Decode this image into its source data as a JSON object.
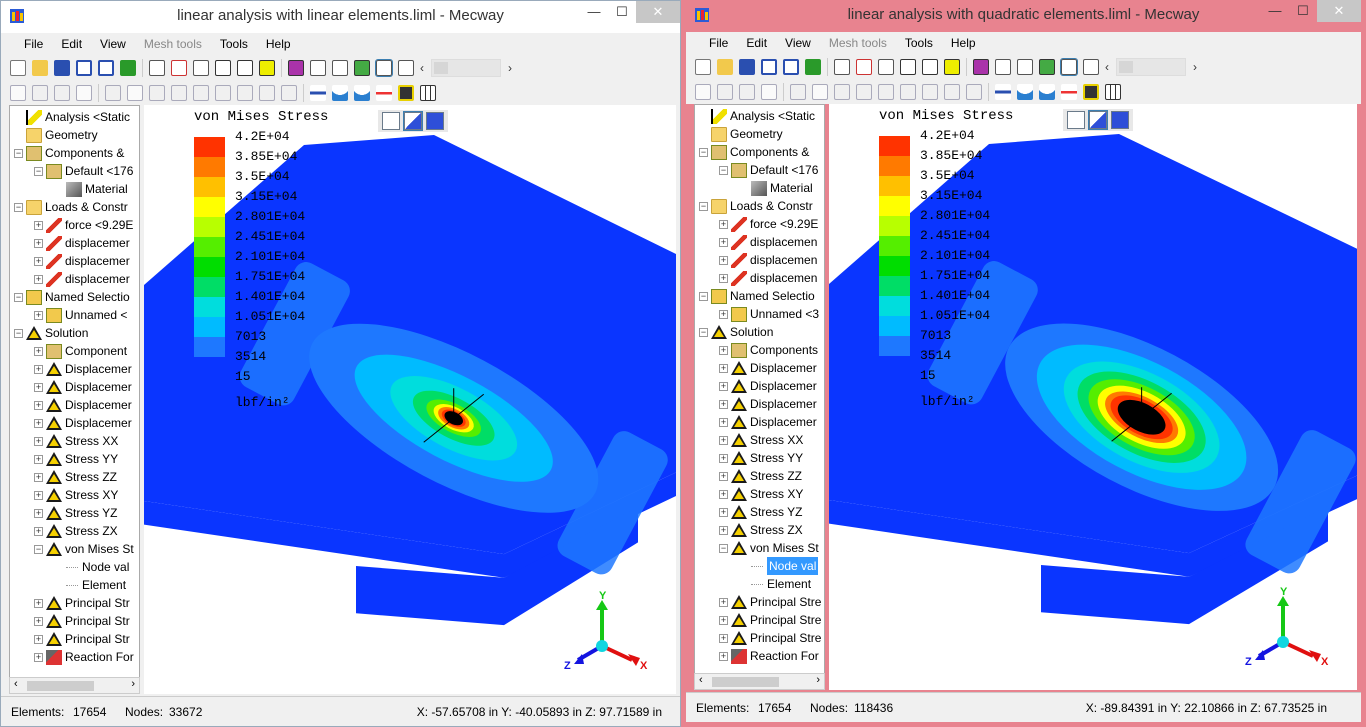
{
  "windows": [
    {
      "title": "linear analysis with linear elements.liml - Mecway",
      "menus": [
        "File",
        "Edit",
        "View",
        "Mesh tools",
        "Tools",
        "Help"
      ],
      "tree": [
        {
          "indent": 0,
          "icon": "bolt",
          "exp": "",
          "label": "Analysis <Static"
        },
        {
          "indent": 0,
          "icon": "folder",
          "exp": "",
          "label": "Geometry"
        },
        {
          "indent": 0,
          "icon": "comp",
          "exp": "−",
          "label": "Components &"
        },
        {
          "indent": 1,
          "icon": "comp",
          "exp": "−",
          "label": "Default <176"
        },
        {
          "indent": 2,
          "icon": "mat",
          "exp": "",
          "label": "Material"
        },
        {
          "indent": 0,
          "icon": "folder",
          "exp": "−",
          "label": "Loads & Constr"
        },
        {
          "indent": 1,
          "icon": "arrow",
          "exp": "+",
          "label": "force <9.29E"
        },
        {
          "indent": 1,
          "icon": "arrow",
          "exp": "+",
          "label": "displacemer"
        },
        {
          "indent": 1,
          "icon": "arrow",
          "exp": "+",
          "label": "displacemer"
        },
        {
          "indent": 1,
          "icon": "arrow",
          "exp": "+",
          "label": "displacemer"
        },
        {
          "indent": 0,
          "icon": "box",
          "exp": "−",
          "label": "Named Selectio"
        },
        {
          "indent": 1,
          "icon": "box",
          "exp": "+",
          "label": "Unnamed <"
        },
        {
          "indent": 0,
          "icon": "tri",
          "exp": "−",
          "label": "Solution"
        },
        {
          "indent": 1,
          "icon": "comp",
          "exp": "+",
          "label": "Component"
        },
        {
          "indent": 1,
          "icon": "tri",
          "exp": "+",
          "label": "Displacemer"
        },
        {
          "indent": 1,
          "icon": "tri",
          "exp": "+",
          "label": "Displacemer"
        },
        {
          "indent": 1,
          "icon": "tri",
          "exp": "+",
          "label": "Displacemer"
        },
        {
          "indent": 1,
          "icon": "tri",
          "exp": "+",
          "label": "Displacemer"
        },
        {
          "indent": 1,
          "icon": "tri",
          "exp": "+",
          "label": "Stress XX"
        },
        {
          "indent": 1,
          "icon": "tri",
          "exp": "+",
          "label": "Stress YY"
        },
        {
          "indent": 1,
          "icon": "tri",
          "exp": "+",
          "label": "Stress ZZ"
        },
        {
          "indent": 1,
          "icon": "tri",
          "exp": "+",
          "label": "Stress XY"
        },
        {
          "indent": 1,
          "icon": "tri",
          "exp": "+",
          "label": "Stress YZ"
        },
        {
          "indent": 1,
          "icon": "tri",
          "exp": "+",
          "label": "Stress ZX"
        },
        {
          "indent": 1,
          "icon": "tri",
          "exp": "−",
          "label": "von Mises St"
        },
        {
          "indent": 2,
          "icon": "",
          "exp": "",
          "label": "Node val"
        },
        {
          "indent": 2,
          "icon": "",
          "exp": "",
          "label": "Element"
        },
        {
          "indent": 1,
          "icon": "tri",
          "exp": "+",
          "label": "Principal Str"
        },
        {
          "indent": 1,
          "icon": "tri",
          "exp": "+",
          "label": "Principal Str"
        },
        {
          "indent": 1,
          "icon": "tri",
          "exp": "+",
          "label": "Principal Str"
        },
        {
          "indent": 1,
          "icon": "rxn",
          "exp": "+",
          "label": "Reaction For"
        }
      ],
      "selected_tree_index": -1,
      "legend": {
        "title": "von Mises Stress",
        "unit": "lbf/in²"
      },
      "status": {
        "elements_label": "Elements:",
        "elements": "17654",
        "nodes_label": "Nodes:",
        "nodes": "33672",
        "coords": "X: -57.65708 in Y: -40.05893 in Z: 97.71589 in"
      },
      "hot_zone": "small"
    },
    {
      "title": "linear analysis with quadratic elements.liml - Mecway",
      "menus": [
        "File",
        "Edit",
        "View",
        "Mesh tools",
        "Tools",
        "Help"
      ],
      "tree": [
        {
          "indent": 0,
          "icon": "bolt",
          "exp": "",
          "label": "Analysis <Static"
        },
        {
          "indent": 0,
          "icon": "folder",
          "exp": "",
          "label": "Geometry"
        },
        {
          "indent": 0,
          "icon": "comp",
          "exp": "−",
          "label": "Components &"
        },
        {
          "indent": 1,
          "icon": "comp",
          "exp": "−",
          "label": "Default <176"
        },
        {
          "indent": 2,
          "icon": "mat",
          "exp": "",
          "label": "Material"
        },
        {
          "indent": 0,
          "icon": "folder",
          "exp": "−",
          "label": "Loads & Constr"
        },
        {
          "indent": 1,
          "icon": "arrow",
          "exp": "+",
          "label": "force <9.29E"
        },
        {
          "indent": 1,
          "icon": "arrow",
          "exp": "+",
          "label": "displacemen"
        },
        {
          "indent": 1,
          "icon": "arrow",
          "exp": "+",
          "label": "displacemen"
        },
        {
          "indent": 1,
          "icon": "arrow",
          "exp": "+",
          "label": "displacemen"
        },
        {
          "indent": 0,
          "icon": "box",
          "exp": "−",
          "label": "Named Selectio"
        },
        {
          "indent": 1,
          "icon": "box",
          "exp": "+",
          "label": "Unnamed <3"
        },
        {
          "indent": 0,
          "icon": "tri",
          "exp": "−",
          "label": "Solution"
        },
        {
          "indent": 1,
          "icon": "comp",
          "exp": "+",
          "label": "Components"
        },
        {
          "indent": 1,
          "icon": "tri",
          "exp": "+",
          "label": "Displacemer"
        },
        {
          "indent": 1,
          "icon": "tri",
          "exp": "+",
          "label": "Displacemer"
        },
        {
          "indent": 1,
          "icon": "tri",
          "exp": "+",
          "label": "Displacemer"
        },
        {
          "indent": 1,
          "icon": "tri",
          "exp": "+",
          "label": "Displacemer"
        },
        {
          "indent": 1,
          "icon": "tri",
          "exp": "+",
          "label": "Stress XX"
        },
        {
          "indent": 1,
          "icon": "tri",
          "exp": "+",
          "label": "Stress YY"
        },
        {
          "indent": 1,
          "icon": "tri",
          "exp": "+",
          "label": "Stress ZZ"
        },
        {
          "indent": 1,
          "icon": "tri",
          "exp": "+",
          "label": "Stress XY"
        },
        {
          "indent": 1,
          "icon": "tri",
          "exp": "+",
          "label": "Stress YZ"
        },
        {
          "indent": 1,
          "icon": "tri",
          "exp": "+",
          "label": "Stress ZX"
        },
        {
          "indent": 1,
          "icon": "tri",
          "exp": "−",
          "label": "von Mises St"
        },
        {
          "indent": 2,
          "icon": "",
          "exp": "",
          "label": "Node val"
        },
        {
          "indent": 2,
          "icon": "",
          "exp": "",
          "label": "Element"
        },
        {
          "indent": 1,
          "icon": "tri",
          "exp": "+",
          "label": "Principal Stre"
        },
        {
          "indent": 1,
          "icon": "tri",
          "exp": "+",
          "label": "Principal Stre"
        },
        {
          "indent": 1,
          "icon": "tri",
          "exp": "+",
          "label": "Principal Stre"
        },
        {
          "indent": 1,
          "icon": "rxn",
          "exp": "+",
          "label": "Reaction For"
        }
      ],
      "selected_tree_index": 25,
      "legend": {
        "title": "von Mises Stress",
        "unit": "lbf/in²"
      },
      "status": {
        "elements_label": "Elements:",
        "elements": "17654",
        "nodes_label": "Nodes:",
        "nodes": "118436",
        "coords": "X: -89.84391 in Y: 22.10866 in Z: 67.73525 in"
      },
      "hot_zone": "large"
    }
  ],
  "legend_scale": [
    {
      "label": "4.2E+04",
      "color": ""
    },
    {
      "label": "3.85E+04",
      "color": "#ff3300"
    },
    {
      "label": "3.5E+04",
      "color": "#ff7a00"
    },
    {
      "label": "3.15E+04",
      "color": "#ffc000"
    },
    {
      "label": "2.801E+04",
      "color": "#ffff00"
    },
    {
      "label": "2.451E+04",
      "color": "#b8ff00"
    },
    {
      "label": "2.101E+04",
      "color": "#55ee00"
    },
    {
      "label": "1.751E+04",
      "color": "#00dd00"
    },
    {
      "label": "1.401E+04",
      "color": "#00dd66"
    },
    {
      "label": "1.051E+04",
      "color": "#00dddd"
    },
    {
      "label": "7013",
      "color": "#00bbff"
    },
    {
      "label": "3514",
      "color": "#1e78ff"
    },
    {
      "label": "15",
      "color": ""
    }
  ],
  "colors": {
    "mesh_blue": "#0a35ff",
    "accent": "#3399ff"
  },
  "axis_labels": {
    "x": "X",
    "y": "Y",
    "z": "Z"
  }
}
